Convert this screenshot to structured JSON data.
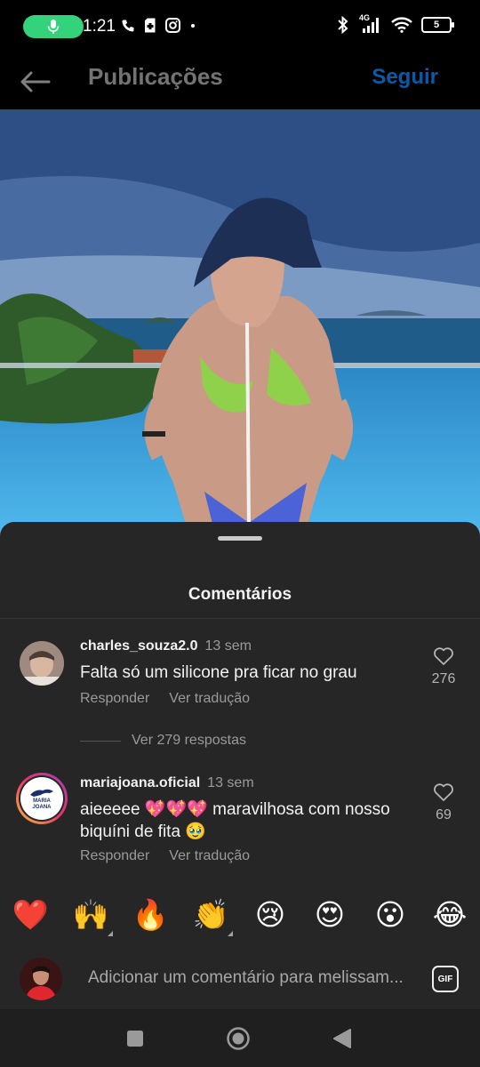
{
  "status_bar": {
    "time": "1:21",
    "network": "4G",
    "battery": "5",
    "icons": [
      "mic-icon",
      "phone-icon",
      "sim-icon",
      "instagram-icon",
      "dot-icon",
      "bluetooth-icon",
      "signal-icon",
      "wifi-icon",
      "battery-icon"
    ]
  },
  "header": {
    "title": "Publicações",
    "follow_label": "Seguir"
  },
  "comments_sheet": {
    "title": "Comentários",
    "comments": [
      {
        "username": "charles_souza2.0",
        "time": "13 sem",
        "text": "Falta só um silicone pra ficar no grau",
        "reply_label": "Responder",
        "translate_label": "Ver tradução",
        "likes": "276",
        "replies_label": "Ver 279 respostas"
      },
      {
        "username": "mariajoana.oficial",
        "time": "13 sem",
        "text": "aieeeee 💖💖💖 maravilhosa com nosso biquíni de fita 🥹",
        "reply_label": "Responder",
        "translate_label": "Ver tradução",
        "likes": "69",
        "avatar_logo_text": "MARIA JOANA"
      }
    ],
    "reactions": [
      "❤️",
      "🙌",
      "🔥",
      "👏",
      "😢",
      "😍",
      "😮",
      "😂"
    ],
    "input_placeholder": "Adicionar um comentário para melissam...",
    "gif_label": "GIF"
  },
  "colors": {
    "sheet_bg": "#262626",
    "follow_blue": "#0a5aa8",
    "mic_green": "#34d27a",
    "muted_text": "#9a9a9a"
  }
}
